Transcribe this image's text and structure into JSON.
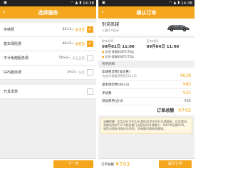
{
  "colors": {
    "accent": "#f4a61d",
    "status_bar": "#222222",
    "background": "#efefef"
  },
  "left": {
    "status_time": "14:38",
    "title": "选择服务",
    "services": [
      {
        "name": "手续费",
        "calc": "35×1=",
        "price": "¥35",
        "checked": true
      },
      {
        "name": "基本保险费",
        "calc": "40×2=",
        "price": "¥80",
        "checked": true
      },
      {
        "name": "不计免赔服务费",
        "calc": "50×2=",
        "price": "¥100",
        "checked": false
      },
      {
        "name": "GPS服务费",
        "calc": "0×2=",
        "price": "¥0",
        "checked": false
      }
    ],
    "invoice_label": "开具发票",
    "next_button": "下一步"
  },
  "right": {
    "status_time": "14:38",
    "title": "确认订单",
    "car": {
      "name": "别克凯越",
      "sub": "三厢|1.6自动"
    },
    "pickup": {
      "label": "取车时间",
      "date": "09月02日",
      "time": "11:00",
      "location": "北京·首都机场T1/T2店"
    },
    "return": {
      "label": "还车时间",
      "date": "09月04日",
      "time": "11:00",
      "location": "北京·首都机场T1/T2店"
    },
    "fee_section_label": "费用明细",
    "fees": [
      {
        "name": "车辆租赁费(含优惠)",
        "calc": "(包含车辆租赁费用314×2)",
        "amount": "¥628"
      },
      {
        "name": "基本保险费(40×2)",
        "calc": "",
        "amount": "¥80"
      },
      {
        "name": "手续费",
        "calc": "",
        "amount": "¥35"
      }
    ],
    "other_fee_label": "其他费用(合计)",
    "other_fee_amount": "¥35",
    "order_total_label": "订单总额",
    "order_total_amount": "¥743",
    "notice": "温馨提醒：8月20日至9月3日期间北京市实行交通管制，在此期间，首都机场的T1/T2航站楼门店营业时间调整为：早8:00至晚8:00，请您合理安排取还车时间，如有疑问请致电客服。",
    "bottom_total_label": "订单总额",
    "bottom_total_amount": "¥743",
    "submit_button": "提交订单"
  }
}
